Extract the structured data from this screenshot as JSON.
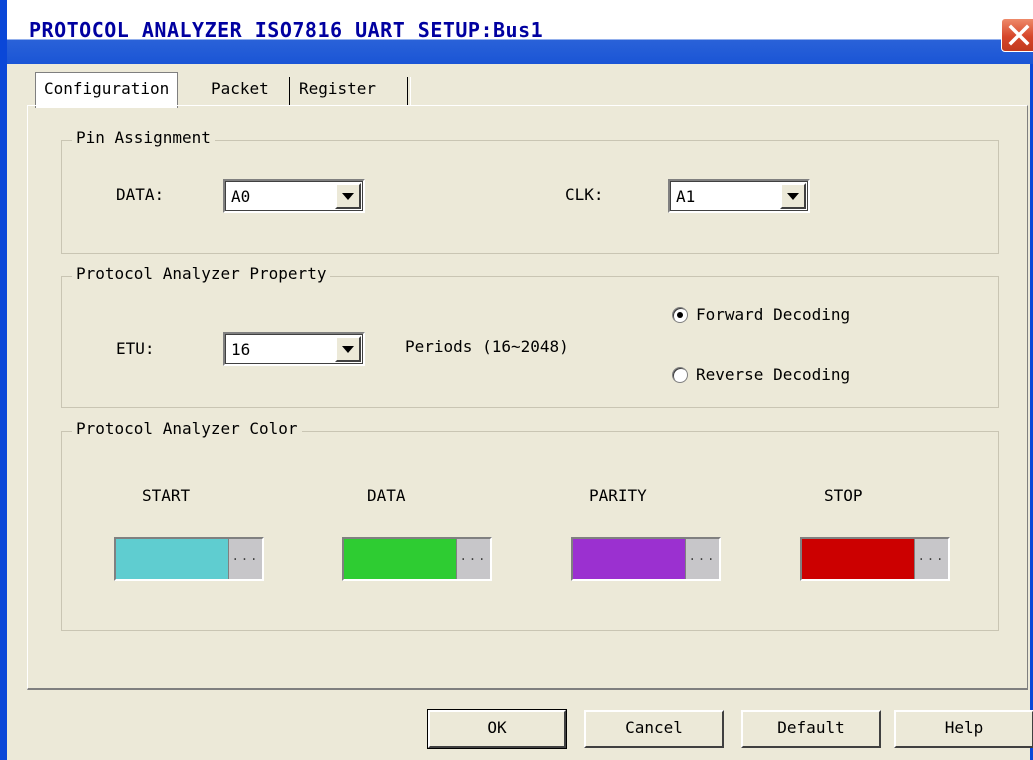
{
  "window": {
    "title": "PROTOCOL ANALYZER ISO7816 UART SETUP:Bus1"
  },
  "tabs": [
    {
      "label": "Configuration",
      "active": true
    },
    {
      "label": "Packet",
      "active": false
    },
    {
      "label": "Register",
      "active": false
    }
  ],
  "pin_assignment": {
    "title": "Pin Assignment",
    "data_label": "DATA:",
    "data_value": "A0",
    "clk_label": "CLK:",
    "clk_value": "A1"
  },
  "property": {
    "title": "Protocol Analyzer Property",
    "etu_label": "ETU:",
    "etu_value": "16",
    "periods_text": "Periods (16~2048)",
    "forward_label": "Forward Decoding",
    "reverse_label": "Reverse Decoding",
    "selected": "forward"
  },
  "colors": {
    "title": "Protocol Analyzer Color",
    "items": [
      {
        "label": "START",
        "color": "#5fcdd0"
      },
      {
        "label": "DATA",
        "color": "#2ecc32"
      },
      {
        "label": "PARITY",
        "color": "#9b30d0"
      },
      {
        "label": "STOP",
        "color": "#cc0000"
      }
    ],
    "dots": "..."
  },
  "buttons": {
    "ok": "OK",
    "cancel": "Cancel",
    "default": "Default",
    "help": "Help"
  }
}
